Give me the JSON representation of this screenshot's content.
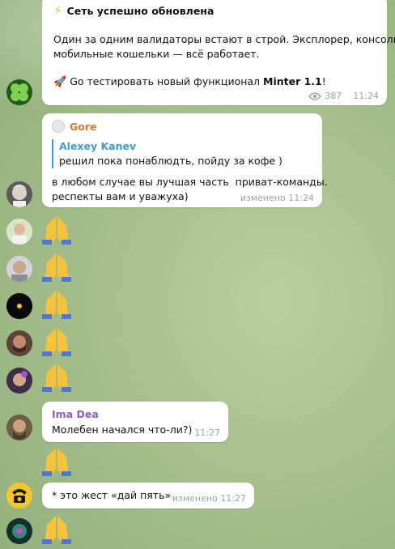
{
  "channel_post": {
    "title_icon": "lightning-emoji",
    "title": "Сеть успешно обновлена",
    "line1": "Один за одним валидаторы встают в строй. Эксплорер, консоль,",
    "line2": "мобильные кошельки — всё работает.",
    "cta_icon": "rocket-emoji",
    "cta_text": "Go тестировать новый функционал ",
    "cta_bold": "Minter 1.1",
    "cta_tail": "!",
    "views": "387",
    "time": "11:24",
    "avatar_icon": "clover-avatar"
  },
  "messages": [
    {
      "author": "Gore",
      "author_color": "#d9782b",
      "reply_author": "Alexey Kanev",
      "reply_text": "решил пока понаблюдть, пойду за кофе )",
      "text_line1": "в любом случае вы лучшая часть  приват-команды.",
      "text_line2": "респекты вам и уважуха)",
      "edited_time": "изменено 11:24"
    },
    {
      "author": "Ima Dea",
      "author_color": "#8e5bc8",
      "text": "Молебен начался что-ли?)",
      "time": "11:27"
    },
    {
      "text": "* это жест «дай пять»",
      "edited_time": "изменено 11:27"
    }
  ],
  "stickers": {
    "icon": "folded-hands-emoji",
    "count": 7
  },
  "colors": {
    "link_blue": "#3f9ad9",
    "emoji_yellow": "#f6c23b",
    "meta_gray": "#9aa3a8"
  }
}
